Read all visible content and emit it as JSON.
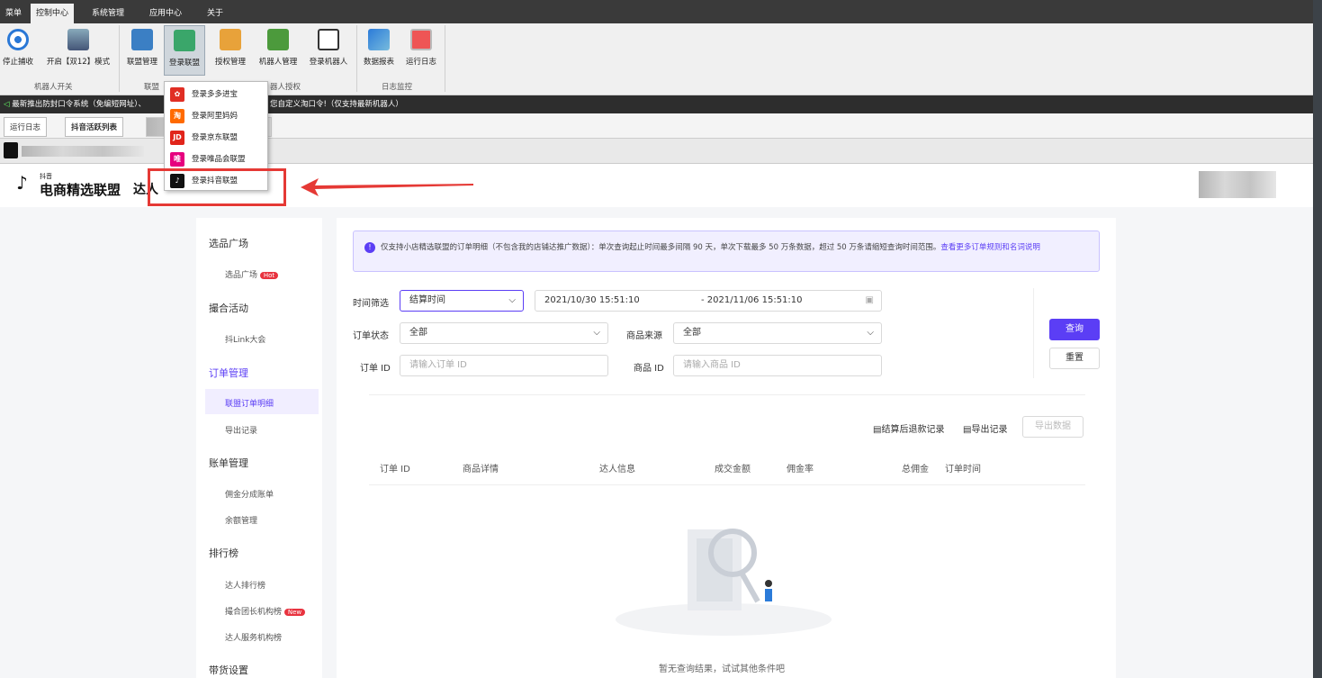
{
  "menu_tabs": [
    "菜单",
    "控制中心",
    "系统管理",
    "应用中心",
    "关于"
  ],
  "ribbon": {
    "buttons": [
      "停止捕收",
      "开启【双12】模式",
      "联盟管理",
      "登录联盟",
      "授权管理",
      "机器人管理",
      "登录机器人",
      "数据报表",
      "运行日志"
    ],
    "groups": [
      "机器人开关",
      "联盟",
      "器人授权",
      "日志监控"
    ]
  },
  "news": "最新推出防封口令系统（免编短网址）、",
  "news_tail": "您自定义淘口令!（仅支持最新机器人）",
  "page_tabs": [
    "运行日志",
    "抖音活跃列表"
  ],
  "dropdown": [
    "登录多多进宝",
    "登录阿里妈妈",
    "登录京东联盟",
    "登录唯品会联盟",
    "登录抖音联盟"
  ],
  "dropdown_icons": [
    "淘",
    "JD",
    "唯"
  ],
  "header": {
    "logo_small": "抖音",
    "logo": "电商精选联盟",
    "role": "达人"
  },
  "sidebar": {
    "s1": "选品广场",
    "s1_items": [
      "选品广场"
    ],
    "hot": "Hot",
    "s2": "撮合活动",
    "s2_items": [
      "抖Link大会"
    ],
    "s3": "订单管理",
    "s3_items": [
      "联盟订单明细",
      "导出记录"
    ],
    "s4": "账单管理",
    "s4_items": [
      "佣金分成账单",
      "余额管理"
    ],
    "s5": "排行榜",
    "s5_items": [
      "达人排行榜",
      "撮合团长机构榜",
      "达人服务机构榜"
    ],
    "new": "New",
    "s6": "带货设置"
  },
  "notice": {
    "text": "仅支持小店精选联盟的订单明细（不包含我的店铺达推广数据）：单次查询起止时间最多间隔 90 天，单次下载最多 50 万条数据，超过 50 万条请缩短查询时间范围。",
    "link": "查看更多订单规则和名词说明"
  },
  "filters": {
    "time_label": "时间筛选",
    "time_value": "结算时间",
    "date_start": "2021/10/30 15:51:10",
    "date_end": "- 2021/11/06 15:51:10",
    "status_label": "订单状态",
    "status_value": "全部",
    "source_label": "商品来源",
    "source_value": "全部",
    "order_label": "订单 ID",
    "order_ph": "请输入订单 ID",
    "product_label": "商品 ID",
    "product_ph": "请输入商品 ID",
    "query": "查询",
    "reset": "重置"
  },
  "actions": {
    "refund": "结算后退款记录",
    "export_log": "导出记录",
    "export_btn": "导出数据"
  },
  "table": {
    "headers": [
      "订单 ID",
      "商品详情",
      "达人信息",
      "成交金额",
      "佣金率",
      "总佣金",
      "订单时间"
    ]
  },
  "empty": "暂无查询结果，试试其他条件吧",
  "colors": {
    "accent": "#5b3ef5",
    "red": "#e53935"
  }
}
